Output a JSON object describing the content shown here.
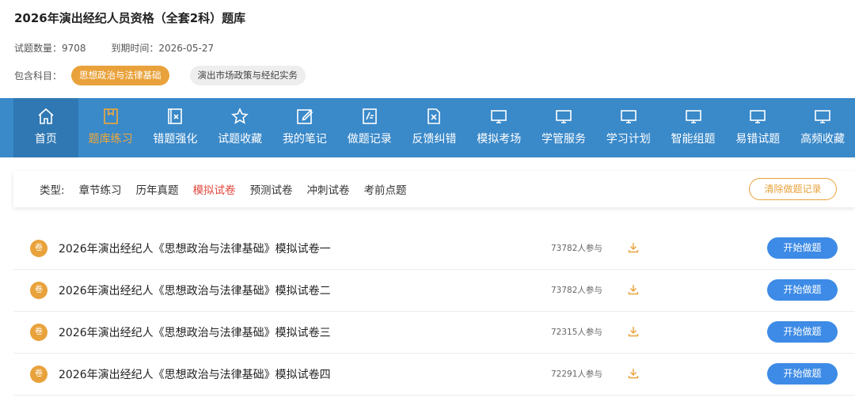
{
  "header": {
    "title": "2026年演出经纪人员资格（全套2科）题库",
    "question_count": "试题数量：9708",
    "expire": "到期时间：2026-05-27",
    "subjects_label": "包含科目：",
    "subjects": [
      "思想政治与法律基础",
      "演出市场政策与经纪实务"
    ]
  },
  "nav": {
    "items": [
      {
        "label": "首页",
        "icon": "home-icon"
      },
      {
        "label": "题库练习",
        "icon": "bookmark-icon"
      },
      {
        "label": "错题强化",
        "icon": "error-book-icon"
      },
      {
        "label": "试题收藏",
        "icon": "star-icon"
      },
      {
        "label": "我的笔记",
        "icon": "edit-icon"
      },
      {
        "label": "做题记录",
        "icon": "record-icon"
      },
      {
        "label": "反馈纠错",
        "icon": "feedback-icon"
      },
      {
        "label": "模拟考场",
        "icon": "monitor-icon"
      },
      {
        "label": "学管服务",
        "icon": "monitor-icon"
      },
      {
        "label": "学习计划",
        "icon": "monitor-icon"
      },
      {
        "label": "智能组题",
        "icon": "monitor-icon"
      },
      {
        "label": "易错试题",
        "icon": "monitor-icon"
      },
      {
        "label": "高频收藏",
        "icon": "monitor-icon"
      }
    ],
    "active_index": 1
  },
  "filter": {
    "type_label": "类型:",
    "items": [
      "章节练习",
      "历年真题",
      "模拟试卷",
      "预测试卷",
      "冲刺试卷",
      "考前点题"
    ],
    "active_index": 2,
    "clear_label": "清除做题记录"
  },
  "list": {
    "badge": "卷",
    "start_label": "开始做题",
    "rows": [
      {
        "title": "2026年演出经纪人《思想政治与法律基础》模拟试卷一",
        "participants": "73782人参与"
      },
      {
        "title": "2026年演出经纪人《思想政治与法律基础》模拟试卷二",
        "participants": "73782人参与"
      },
      {
        "title": "2026年演出经纪人《思想政治与法律基础》模拟试卷三",
        "participants": "72315人参与"
      },
      {
        "title": "2026年演出经纪人《思想政治与法律基础》模拟试卷四",
        "participants": "72291人参与"
      }
    ]
  },
  "colors": {
    "nav_bg": "#3a89c9",
    "accent_orange": "#e9a23b",
    "active_red": "#e1463a",
    "button_blue": "#3d8be6"
  }
}
